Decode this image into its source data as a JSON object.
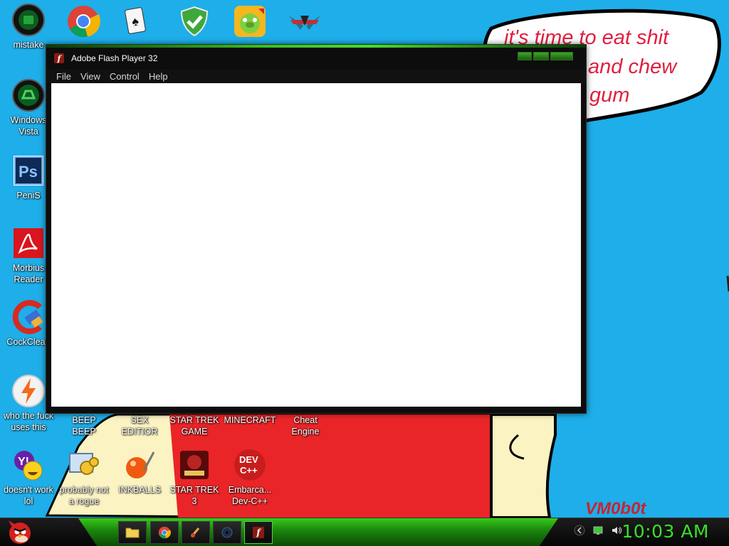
{
  "wallpaper": {
    "speech_lines": [
      "it's time to eat shit",
      "and chew",
      "gum"
    ],
    "signature": "VM0b0t",
    "colors": {
      "sky": "#1eaee9",
      "speech_text": "#e01f3f",
      "shirt": "#ea2528",
      "skin": "#fbf3c2",
      "signature": "#c72433"
    }
  },
  "desktop_icons": {
    "mistake": "mistake",
    "windows_vista": "Windows\nVista",
    "penis": "PeniS",
    "morbius_reader": "Morbius\nReader",
    "cockclean": "CockClean",
    "who_uses": "who the fuck\nuses this",
    "beep_beep": "BEEP\nBEEP",
    "sex_editor": "SEX\nEDITIOR",
    "star_trek_game": "STAR TREK\nGAME",
    "minecraft": "MINECRAFT",
    "cheat_engine": "Cheat\nEngine",
    "doesnt_work": "doesn't work\nlol",
    "probably_not": "probably not\na rogue",
    "inkballs": "INKBALLS",
    "star_trek_3": "STAR TREK\n3",
    "embarca": "Embarca...\nDev-C++"
  },
  "flash_window": {
    "title": "Adobe Flash Player 32",
    "icon_glyph": "f",
    "menu": [
      "File",
      "View",
      "Control",
      "Help"
    ]
  },
  "taskbar": {
    "clock": "10:03 AM",
    "accent": "#38e02a"
  }
}
